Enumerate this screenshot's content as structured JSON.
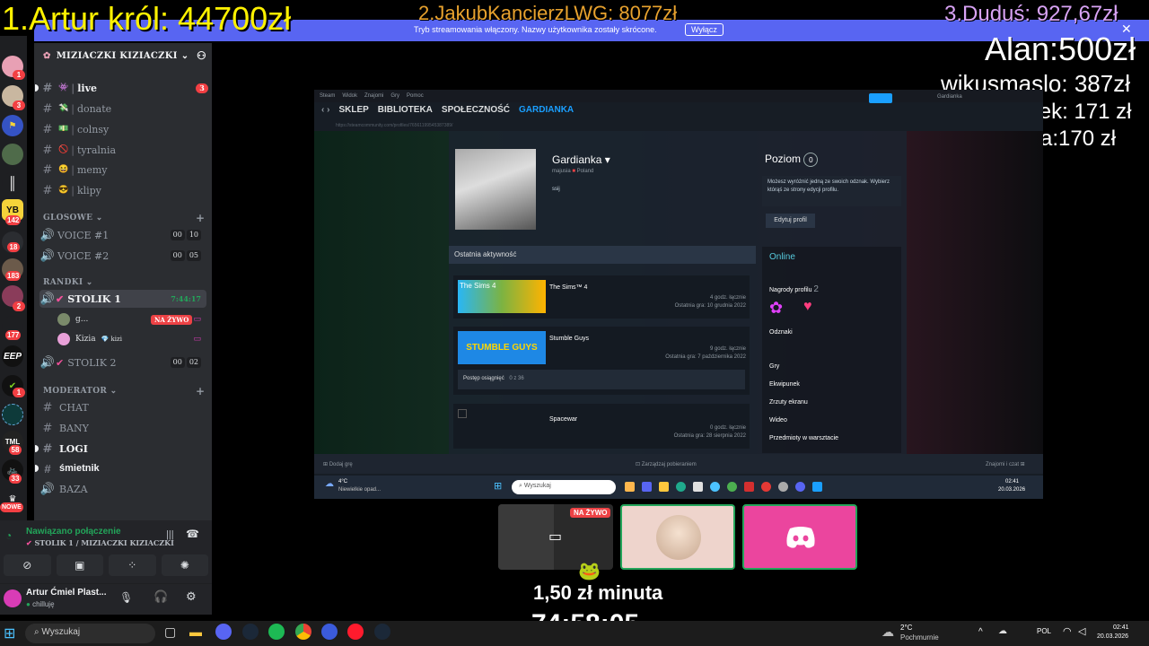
{
  "overlay": {
    "donor1": "1.Artur król: 44700zł",
    "donor2": "2.JakubKancierzLWG: 8077zł",
    "donor3": "3.Duduś: 927,67zł",
    "donors_rest": [
      "Alan:500zł",
      "wikusmaslo: 387zł",
      "Warsztek: 171 zł",
      "kresida:170 zł"
    ],
    "rate": "1,50 zł minuta",
    "timer": "74:58:05"
  },
  "streaming_banner": {
    "text": "Tryb streamowania włączony. Nazwy użytkownika zostały skrócone.",
    "button": "Wyłącz"
  },
  "rail": {
    "badges": [
      "1",
      "3",
      "142",
      "18",
      "183",
      "2",
      "177",
      "1",
      "58",
      "33"
    ],
    "labels": [
      "YB",
      "EEP",
      "TML",
      "NOWE"
    ]
  },
  "server": {
    "name": "MIZIACZKI KIZIACZKI",
    "channels": [
      {
        "label": "live",
        "emoji": "👾",
        "badge": "3"
      },
      {
        "label": "donate",
        "emoji": "💸"
      },
      {
        "label": "colnsy",
        "emoji": "💵"
      },
      {
        "label": "tyralnia",
        "emoji": "🚫"
      },
      {
        "label": "memy",
        "emoji": "😆"
      },
      {
        "label": "klipy",
        "emoji": "😎"
      }
    ],
    "cat_glosowe": "GLOSOWE",
    "voice": [
      {
        "label": "VOICE #1",
        "a": "00",
        "b": "10"
      },
      {
        "label": "VOICE #2",
        "a": "00",
        "b": "05"
      }
    ],
    "cat_randki": "RANDKI",
    "stolik1": {
      "label": "STOLIK 1",
      "time": "7:44:17"
    },
    "members": [
      {
        "name": "g...",
        "tag": "NA ŻYWO"
      },
      {
        "name": "Kizia",
        "sub": "kizi"
      }
    ],
    "stolik2": {
      "label": "STOLIK 2",
      "a": "00",
      "b": "02"
    },
    "cat_moderator": "MODERATOR",
    "mod_channels": [
      "CHAT",
      "BANY",
      "LOGI",
      "śmietnik",
      "BAZA"
    ]
  },
  "voice_panel": {
    "status": "Nawiązano połączenie",
    "location": "STOLIK 1 / MIZIACZKI KIZIACZKI"
  },
  "user": {
    "name": "Artur Ćmiel Plast...",
    "status": "chilluję"
  },
  "steam": {
    "menu": [
      "Steam",
      "Widok",
      "Znajomi",
      "Gry",
      "Pomoc"
    ],
    "nav": [
      "SKLEP",
      "BIBLIOTEKA",
      "SPOŁECZNOŚĆ",
      "GARDIANKA"
    ],
    "account": "Gardianka",
    "url": "https://steamcommunity.com/profiles/76561199545387389/",
    "profile": {
      "name": "Gardianka",
      "sub": "majusia",
      "country": "Poland",
      "bio": "ssij",
      "level_label": "Poziom",
      "level": "0",
      "badge_hint": "Możesz wyróżnić jedną ze swoich odznak. Wybierz którąś ze strony edycji profilu.",
      "edit": "Edytuj profil",
      "status": "Online",
      "awards_label": "Nagrody profilu",
      "awards_count": "2",
      "badges_label": "Odznaki",
      "side_links": [
        "Gry",
        "Ekwipunek",
        "Zrzuty ekranu",
        "Wideo",
        "Przedmioty w warsztacie"
      ]
    },
    "activity_title": "Ostatnia aktywność",
    "games": [
      {
        "name": "The Sims™ 4",
        "hours": "4 godz. łącznie",
        "last": "Ostatnia gra: 10 grudnia 2022",
        "art": "The Sims 4"
      },
      {
        "name": "Stumble Guys",
        "hours": "9 godz. łącznie",
        "last": "Ostatnia gra: 7 października 2022",
        "art": "STUMBLE GUYS",
        "progress_label": "Postęp osiągnięć",
        "progress": "0 z 36"
      },
      {
        "name": "Spacewar",
        "hours": "0 godz. łącznie",
        "last": "Ostatnia gra: 28 sierpnia 2022"
      }
    ],
    "footer_left": "Dodaj grę",
    "footer_mid": "Zarządzaj pobieraniem",
    "footer_right": "Znajomi i czat"
  },
  "inner_taskbar": {
    "weather_temp": "4°C",
    "weather_desc": "Niewielkie opad...",
    "search": "Wyszukaj",
    "time": "02:41",
    "date": "20.03.2026"
  },
  "tiles": {
    "live_tag": "NA ŻYWO"
  },
  "taskbar": {
    "search": "Wyszukaj",
    "weather_temp": "2°C",
    "weather_desc": "Pochmurnie",
    "lang": "POL",
    "time": "02:41",
    "date": "20.03.2026"
  },
  "colors": {
    "accent": "#5865f2",
    "live": "#ed4245",
    "online": "#23a55a",
    "steam_blue": "#1a9fff"
  }
}
